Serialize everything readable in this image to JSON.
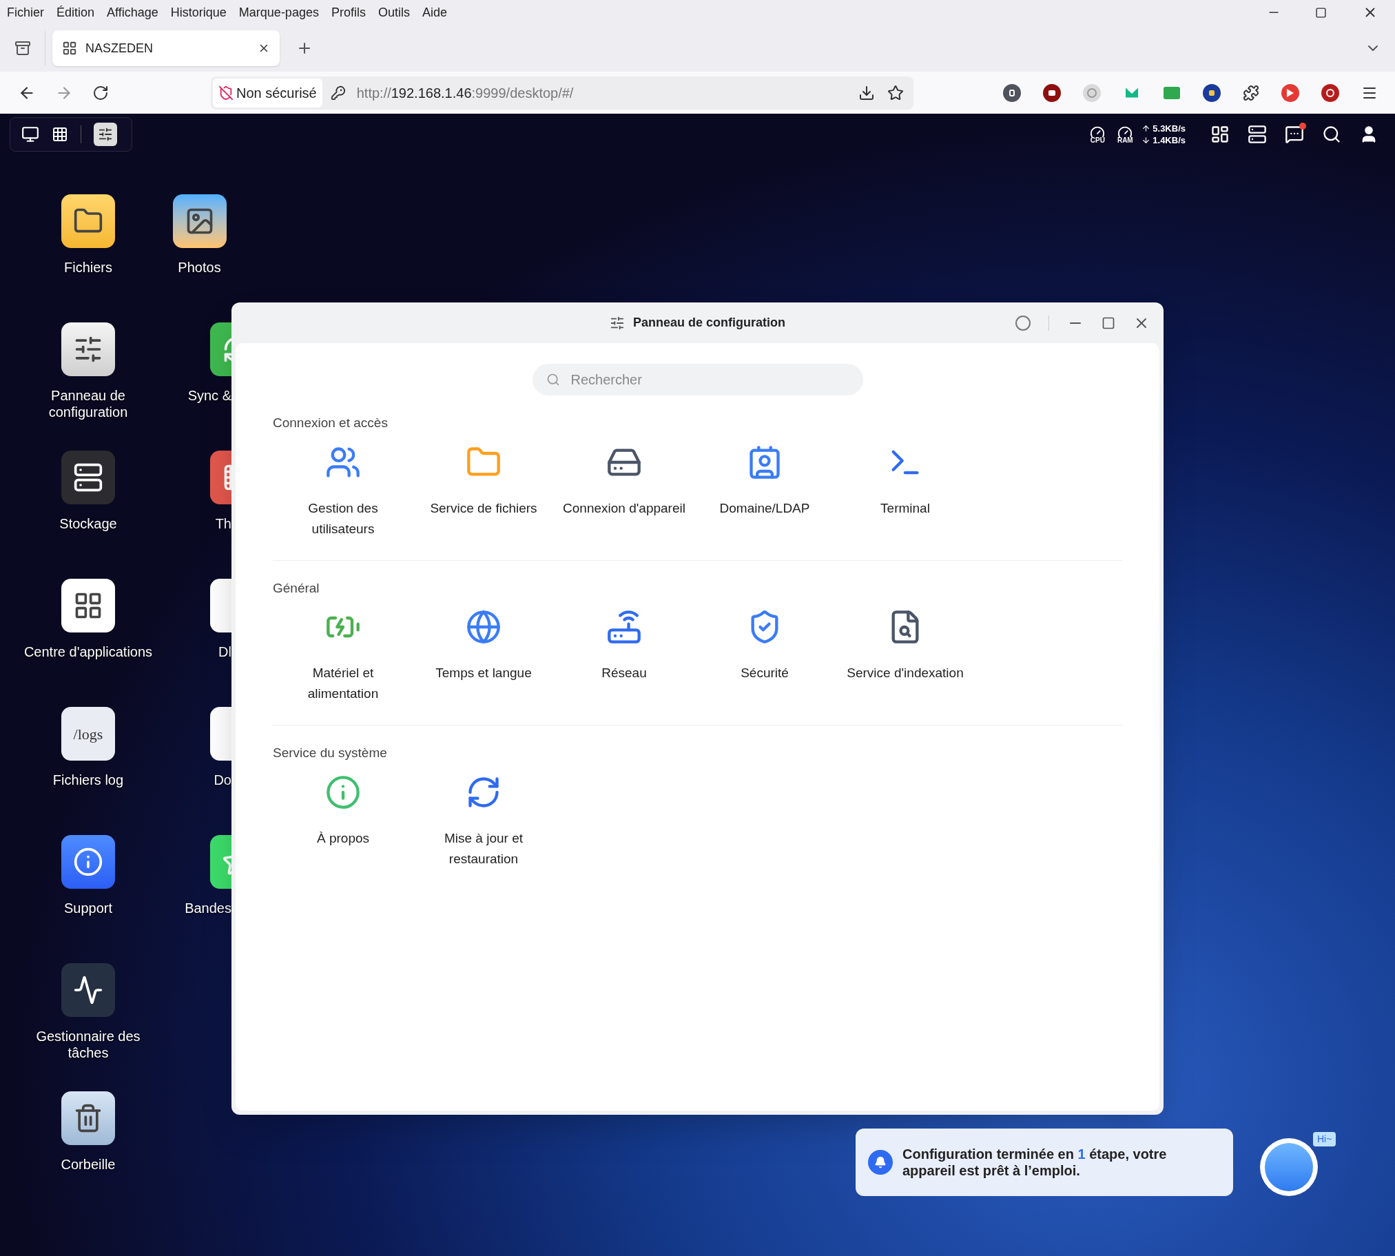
{
  "browser": {
    "menu": [
      "Fichier",
      "Édition",
      "Affichage",
      "Historique",
      "Marque-pages",
      "Profils",
      "Outils",
      "Aide"
    ],
    "tab": {
      "title": "NASZEDEN",
      "selected": true
    },
    "address": {
      "security": "Non sécurisé",
      "url_scheme": "http://",
      "url_host": "192.168.1.46",
      "url_path": ":9999/desktop/#/"
    }
  },
  "taskbar": {
    "cpu_label": "CPU",
    "ram_label": "RAM",
    "upload": "5.3KB/s",
    "download": "1.4KB/s",
    "messages_unread": true
  },
  "desktop": {
    "column_1": [
      "Fichiers",
      "Panneau de configuration",
      "Stockage",
      "Centre d'applications",
      "Fichiers log",
      "Support",
      "Gestionnaire des tâches",
      "Corbeille"
    ],
    "column_2": [
      "Photos",
      "Sync &",
      "Th",
      "Dl",
      "Do",
      "Bandes"
    ],
    "log_icon_caption": "/logs"
  },
  "window": {
    "title": "Panneau de configuration",
    "search": {
      "placeholder": "Rechercher"
    },
    "sections": [
      {
        "title": "Connexion et accès",
        "items": [
          "Gestion des utilisateurs",
          "Service de fichiers",
          "Connexion d'appareil",
          "Domaine/LDAP",
          "Terminal"
        ]
      },
      {
        "title": "Général",
        "items": [
          "Matériel et alimentation",
          "Temps et langue",
          "Réseau",
          "Sécurité",
          "Service d'indexation"
        ]
      },
      {
        "title": "Service du système",
        "items": [
          "À propos",
          "Mise à jour et restauration"
        ]
      }
    ]
  },
  "notification": {
    "message_start": "Configuration terminée en ",
    "message_count": "1",
    "message_end": " étape, votre appareil est prêt à l’emploi."
  },
  "assistant": {
    "bubble": "Hi~"
  }
}
